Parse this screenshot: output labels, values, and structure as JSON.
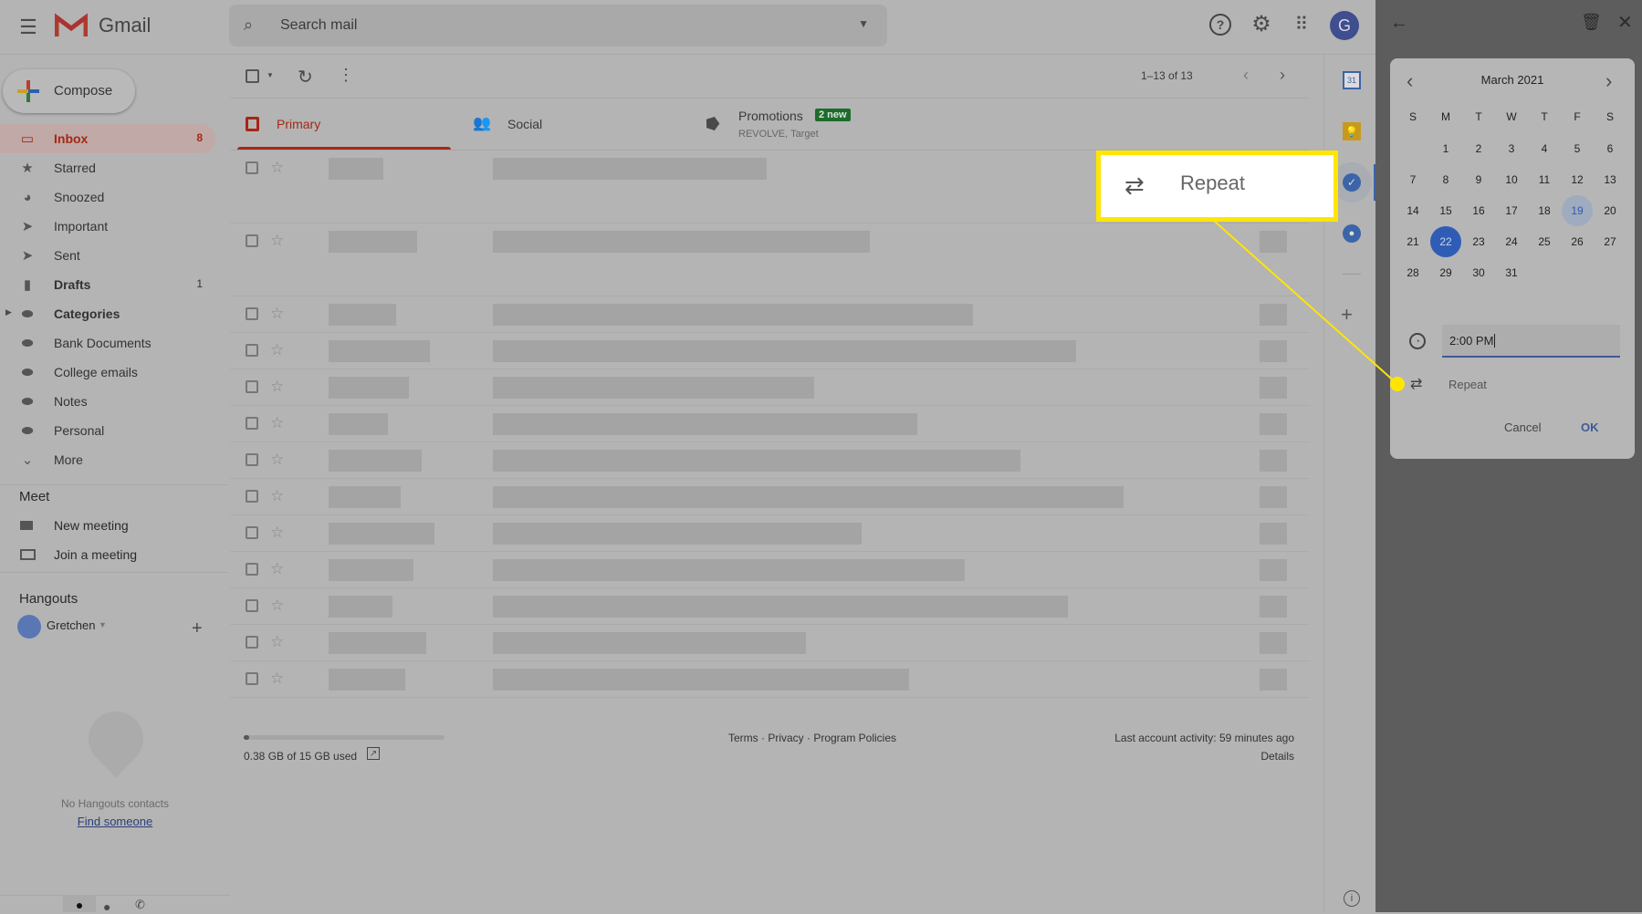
{
  "header": {
    "app_name": "Gmail",
    "search_placeholder": "Search mail",
    "avatar_letter": "G"
  },
  "compose_label": "Compose",
  "sidebar": {
    "items": [
      {
        "label": "Inbox",
        "count": "8",
        "icon": "inbox-icon",
        "bold": true,
        "active": true
      },
      {
        "label": "Starred",
        "count": "",
        "icon": "star-icon"
      },
      {
        "label": "Snoozed",
        "count": "",
        "icon": "clock-icon"
      },
      {
        "label": "Important",
        "count": "",
        "icon": "important-icon"
      },
      {
        "label": "Sent",
        "count": "",
        "icon": "send-icon"
      },
      {
        "label": "Drafts",
        "count": "1",
        "icon": "draft-icon",
        "bold": true
      },
      {
        "label": "Categories",
        "count": "",
        "icon": "label-icon",
        "bold": true
      },
      {
        "label": "Bank Documents",
        "count": "",
        "icon": "label-icon"
      },
      {
        "label": "College emails",
        "count": "",
        "icon": "label-icon"
      },
      {
        "label": "Notes",
        "count": "",
        "icon": "label-icon"
      },
      {
        "label": "Personal",
        "count": "",
        "icon": "label-icon"
      },
      {
        "label": "More",
        "count": "",
        "icon": "chevron-down-icon"
      }
    ],
    "meet": {
      "heading": "Meet",
      "new_meeting": "New meeting",
      "join": "Join a meeting"
    },
    "hangouts": {
      "heading": "Hangouts",
      "user": "Gretchen",
      "empty": "No Hangouts contacts",
      "find": "Find someone"
    }
  },
  "toolbar": {
    "pagination": "1–13 of 13"
  },
  "tabs": [
    {
      "label": "Primary"
    },
    {
      "label": "Social"
    },
    {
      "label": "Promotions",
      "badge": "2 new",
      "sub": "REVOLVE, Target"
    }
  ],
  "footer": {
    "storage": "0.38 GB of 15 GB used",
    "storage_fraction": 0.025,
    "links": "Terms · Privacy · Program Policies",
    "activity": "Last account activity: 59 minutes ago",
    "details": "Details"
  },
  "callout": {
    "label": "Repeat"
  },
  "calendar": {
    "month": "March 2021",
    "weekdays": [
      "S",
      "M",
      "T",
      "W",
      "T",
      "F",
      "S"
    ],
    "first_weekday": 1,
    "days": 31,
    "selected": 22,
    "today": 19,
    "time": "2:00 PM",
    "repeat": "Repeat",
    "cancel": "Cancel",
    "ok": "OK"
  },
  "colors": {
    "accent": "#3367d6",
    "inbox_red": "#a52714",
    "highlight": "#ffe600",
    "badge": "#1e6b2c"
  }
}
